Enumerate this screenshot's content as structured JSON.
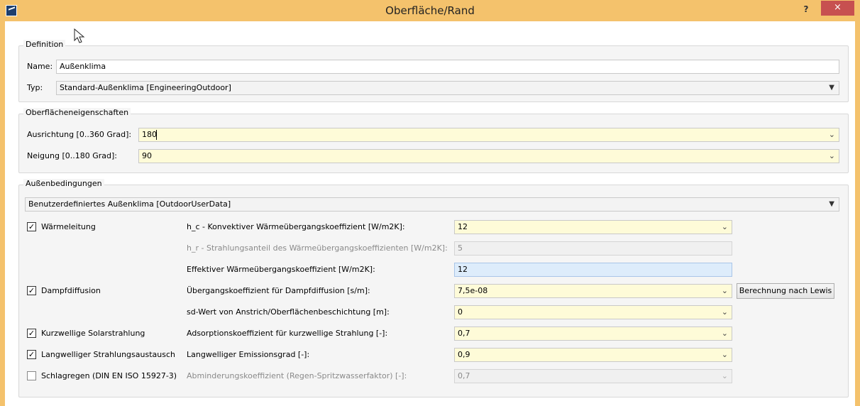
{
  "window": {
    "title": "Oberfläche/Rand",
    "help": "?",
    "close": "×"
  },
  "definition": {
    "group_title": "Definition",
    "name_label": "Name:",
    "name_value": "Außenklima",
    "typ_label": "Typ:",
    "typ_value": "Standard-Außenklima [EngineeringOutdoor]"
  },
  "surface": {
    "group_title": "Oberflächeneigenschaften",
    "ausrichtung_label": "Ausrichtung [0..360 Grad]:",
    "ausrichtung_value": "180",
    "neigung_label": "Neigung [0..180 Grad]:",
    "neigung_value": "90"
  },
  "outdoor": {
    "group_title": "Außenbedingungen",
    "climate_value": "Benutzerdefiniertes Außenklima [OutdoorUserData]",
    "checks": [
      {
        "label": "Wärmeleitung",
        "checked": true
      },
      {
        "label": "Dampfdiffusion",
        "checked": true
      },
      {
        "label": "Kurzwellige Solarstrahlung",
        "checked": true
      },
      {
        "label": "Langwelliger Strahlungsaustausch",
        "checked": true
      },
      {
        "label": "Schlagregen (DIN EN ISO 15927-3)",
        "checked": false
      }
    ],
    "rows": [
      {
        "label": "h_c - Konvektiver Wärmeübergangskoeffizient [W/m2K]:",
        "value": "12"
      },
      {
        "label": "h_r - Strahlungsanteil des Wärmeübergangskoeffizienten [W/m2K]:",
        "value": "5"
      },
      {
        "label": "Effektiver Wärmeübergangskoeffizient [W/m2K]:",
        "value": "12"
      },
      {
        "label": "Übergangskoeffizient für Dampfdiffusion [s/m]:",
        "value": "7,5e-08"
      },
      {
        "label": "sd-Wert von Anstrich/Oberflächenbeschichtung [m]:",
        "value": "0"
      },
      {
        "label": "Adsorptionskoeffizient für kurzwellige Strahlung [-]:",
        "value": "0,7"
      },
      {
        "label": "Langwelliger Emissionsgrad [-]:",
        "value": "0,9"
      },
      {
        "label": "Abminderungskoeffizient (Regen-Spritzwasserfaktor) [-]:",
        "value": "0,7"
      }
    ],
    "lewis_button": "Berechnung nach Lewis"
  }
}
